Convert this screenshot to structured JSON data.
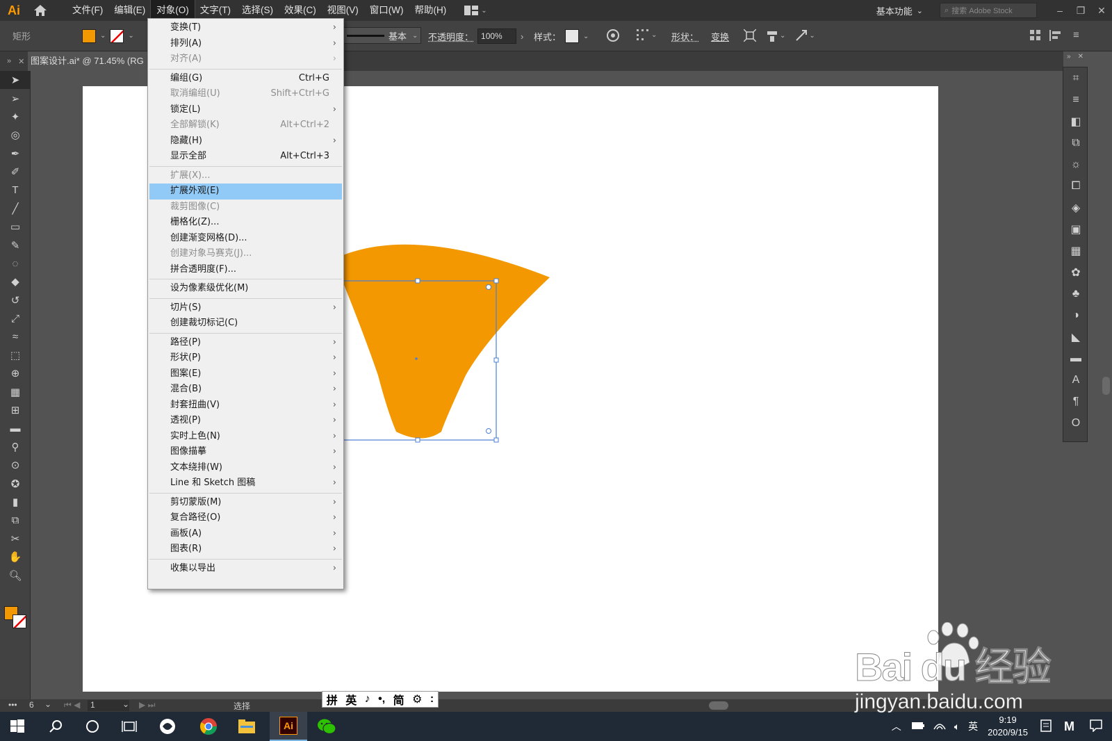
{
  "app": {
    "logo": "Ai"
  },
  "menubar": {
    "items": [
      "文件(F)",
      "编辑(E)",
      "对象(O)",
      "文字(T)",
      "选择(S)",
      "效果(C)",
      "视图(V)",
      "窗口(W)",
      "帮助(H)"
    ],
    "active": "对象(O)",
    "workspace": "基本功能",
    "search_placeholder": "搜索 Adobe Stock"
  },
  "controlbar": {
    "selection_label": "矩形",
    "fill_color": "#f39800",
    "stroke_label": "基本",
    "opacity_label": "不透明度：",
    "opacity_value": "100%",
    "style_label": "样式：",
    "shape_label": "形状：",
    "transform_label": "变换"
  },
  "document": {
    "tab_title": "图案设计.ai* @ 71.45% (RG"
  },
  "status": {
    "zoom": "6",
    "artboard_number": "1",
    "tool_hint": "选择"
  },
  "ime": {
    "items": [
      "拼",
      "英",
      "♪",
      "•,",
      "简",
      "⚙",
      ":"
    ]
  },
  "taskbar": {
    "time": "9:19",
    "date": "2020/9/15",
    "ime_lang": "英"
  },
  "watermark": {
    "brand": "Bai du 经验",
    "url": "jingyan.baidu.com"
  },
  "dropdown": {
    "items": [
      {
        "label": "变换(T)",
        "submenu": true
      },
      {
        "label": "排列(A)",
        "submenu": true
      },
      {
        "label": "对齐(A)",
        "submenu": true,
        "disabled": true
      },
      {
        "sep": true
      },
      {
        "label": "编组(G)",
        "shortcut": "Ctrl+G"
      },
      {
        "label": "取消编组(U)",
        "shortcut": "Shift+Ctrl+G",
        "disabled": true
      },
      {
        "label": "锁定(L)",
        "submenu": true
      },
      {
        "label": "全部解锁(K)",
        "shortcut": "Alt+Ctrl+2",
        "disabled": true
      },
      {
        "label": "隐藏(H)",
        "submenu": true
      },
      {
        "label": "显示全部",
        "shortcut": "Alt+Ctrl+3"
      },
      {
        "sep": true
      },
      {
        "label": "扩展(X)...",
        "disabled": true
      },
      {
        "label": "扩展外观(E)",
        "highlighted": true
      },
      {
        "label": "裁剪图像(C)",
        "disabled": true
      },
      {
        "label": "栅格化(Z)..."
      },
      {
        "label": "创建渐变网格(D)..."
      },
      {
        "label": "创建对象马赛克(J)...",
        "disabled": true
      },
      {
        "label": "拼合透明度(F)..."
      },
      {
        "sep": true
      },
      {
        "label": "设为像素级优化(M)"
      },
      {
        "sep": true
      },
      {
        "label": "切片(S)",
        "submenu": true
      },
      {
        "label": "创建裁切标记(C)"
      },
      {
        "sep": true
      },
      {
        "label": "路径(P)",
        "submenu": true
      },
      {
        "label": "形状(P)",
        "submenu": true
      },
      {
        "label": "图案(E)",
        "submenu": true
      },
      {
        "label": "混合(B)",
        "submenu": true
      },
      {
        "label": "封套扭曲(V)",
        "submenu": true
      },
      {
        "label": "透视(P)",
        "submenu": true
      },
      {
        "label": "实时上色(N)",
        "submenu": true
      },
      {
        "label": "图像描摹",
        "submenu": true
      },
      {
        "label": "文本绕排(W)",
        "submenu": true
      },
      {
        "label": "Line 和 Sketch 图稿",
        "submenu": true
      },
      {
        "sep": true
      },
      {
        "label": "剪切蒙版(M)",
        "submenu": true
      },
      {
        "label": "复合路径(O)",
        "submenu": true
      },
      {
        "label": "画板(A)",
        "submenu": true
      },
      {
        "label": "图表(R)",
        "submenu": true
      },
      {
        "sep": true
      },
      {
        "label": "收集以导出",
        "submenu": true
      }
    ]
  }
}
